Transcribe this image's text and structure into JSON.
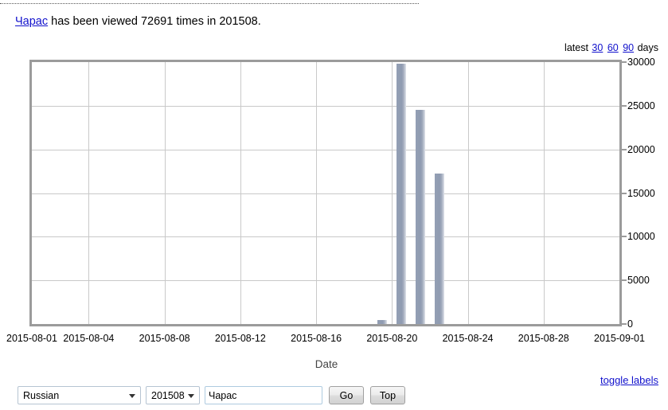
{
  "header": {
    "term": "Чарас",
    "sentence_rest": " has been viewed 72691 times in 201508.",
    "views": "72691",
    "period": "201508"
  },
  "latest": {
    "prefix": "latest",
    "links": [
      "30",
      "60",
      "90"
    ],
    "suffix": "days"
  },
  "toggle": {
    "label": "toggle labels"
  },
  "form": {
    "language": "Russian",
    "period": "201508",
    "term_value": "Чарас",
    "term_placeholder": "",
    "go_label": "Go",
    "top_label": "Top"
  },
  "chart_data": {
    "type": "bar",
    "title": "",
    "xlabel": "Date",
    "ylabel": "",
    "ylim": [
      0,
      30000
    ],
    "yticks": [
      0,
      5000,
      10000,
      15000,
      20000,
      25000,
      30000
    ],
    "ytick_labels": [
      "0",
      "5000",
      "10000",
      "15000",
      "20000",
      "25000",
      "30000"
    ],
    "xlim": [
      "2015-08-01",
      "2015-09-01"
    ],
    "xtick_labels": [
      "2015-08-01",
      "2015-08-04",
      "2015-08-08",
      "2015-08-12",
      "2015-08-16",
      "2015-08-20",
      "2015-08-24",
      "2015-08-28",
      "2015-09-01"
    ],
    "grid": true,
    "legend": "none",
    "bar_color": "#8f9bb1",
    "categories": [
      "2015-08-01",
      "2015-08-02",
      "2015-08-03",
      "2015-08-04",
      "2015-08-05",
      "2015-08-06",
      "2015-08-07",
      "2015-08-08",
      "2015-08-09",
      "2015-08-10",
      "2015-08-11",
      "2015-08-12",
      "2015-08-13",
      "2015-08-14",
      "2015-08-15",
      "2015-08-16",
      "2015-08-17",
      "2015-08-18",
      "2015-08-19",
      "2015-08-20",
      "2015-08-21",
      "2015-08-22",
      "2015-08-23",
      "2015-08-24",
      "2015-08-25",
      "2015-08-26",
      "2015-08-27",
      "2015-08-28",
      "2015-08-29",
      "2015-08-30",
      "2015-08-31"
    ],
    "values": [
      0,
      0,
      0,
      0,
      0,
      0,
      0,
      0,
      0,
      0,
      0,
      0,
      0,
      0,
      0,
      0,
      0,
      0,
      450,
      29800,
      24500,
      17200,
      0,
      0,
      0,
      0,
      0,
      0,
      0,
      0,
      0
    ]
  }
}
